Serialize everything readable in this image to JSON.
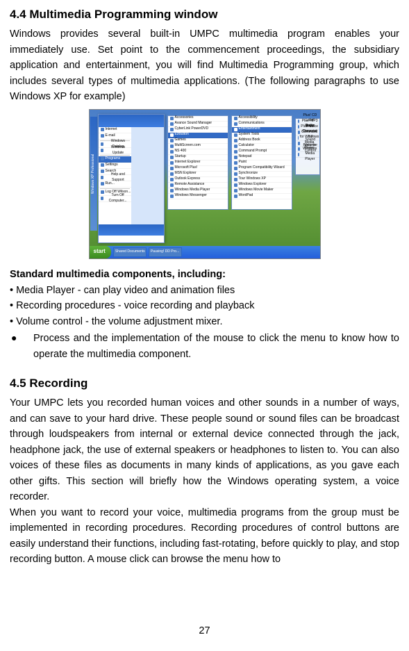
{
  "section1": {
    "heading": "4.4  Multimedia Programming window",
    "para": "Windows provides several built-in UMPC multimedia program enables your immediately use. Set point to the commencement proceedings, the subsidiary application and entertainment, you will find Multimedia Programming group, which includes several types of multimedia applications. (The following paragraphs to use Windows XP for example)"
  },
  "figure": {
    "xp_label": "Windows XP  Professional",
    "start_btn": "start",
    "taskbar_items": [
      "Shared Documents",
      "Pausing! DD Pro..."
    ],
    "left_apps": [
      "Internet",
      "E-mail",
      "Windows Catalog",
      "Windows Update",
      "Programs",
      "Settings",
      "Search",
      "Help and Support",
      "Run...",
      "Log Off Wilson...",
      "Turn Off Computer..."
    ],
    "col1": [
      "Accessories",
      "Avance Sound Manager",
      "CyberLink PowerDVD",
      "EzButton",
      "Games",
      "MultiScreen.com",
      "NS 400",
      "Startup",
      "Internet Explorer",
      "Microsoft Plus!",
      "MSN Explorer",
      "Outlook Express",
      "Remote Assistance",
      "Windows Media Player",
      "Windows Messenger"
    ],
    "col2": [
      "Accessibility",
      "Communications",
      "Entertainment",
      "System Tools",
      "Address Book",
      "Calculator",
      "Command Prompt",
      "Notepad",
      "Paint",
      "Program Compatibility Wizard",
      "Synchronize",
      "Tour Windows XP",
      "Windows Explorer",
      "Windows Movie Maker",
      "WordPad"
    ],
    "col3": [
      "Plus! CD Label Maker",
      "Plus! MP3 Audio Converter",
      "Plus! Personal DJ",
      "Plus! Voice Command for Windows Media Player",
      "Sound Recorder",
      "Volume Control",
      "Windows Media Player"
    ]
  },
  "components": {
    "heading": "Standard multimedia components, including:",
    "items": [
      "• Media Player - can play video and animation files",
      "• Recording procedures - voice recording and playback",
      "• Volume control - the volume adjustment mixer."
    ],
    "process_bullet": "●",
    "process": "Process and the implementation of the mouse to click the menu to know how to operate the multimedia component."
  },
  "section2": {
    "heading": "4.5  Recording",
    "para1": "Your UMPC lets you recorded human voices and other sounds in a number of ways, and can save to your hard drive. These people sound or sound files can be broadcast through loudspeakers from internal or external device connected through the jack, headphone jack, the use of external speakers or headphones to listen to. You can also voices of these files as documents in many kinds of applications, as you gave each other gifts. This section will briefly how the Windows operating system, a voice recorder.",
    "para2": "When you want to record your voice, multimedia programs from the group must be implemented in recording procedures. Recording procedures of control buttons are easily understand their functions, including fast-rotating, before quickly to play, and stop recording button. A mouse click can browse the menu how to"
  },
  "page_number": "27"
}
